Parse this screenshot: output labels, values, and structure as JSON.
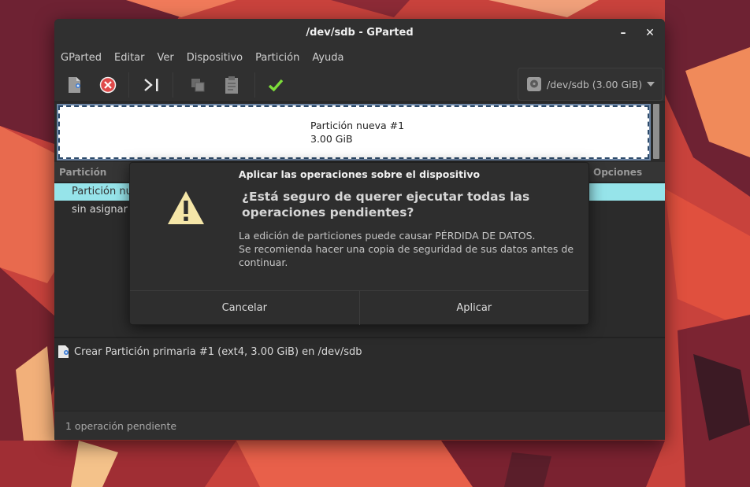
{
  "window": {
    "title": "/dev/sdb - GParted",
    "minimize_glyph": "–",
    "close_glyph": "✕"
  },
  "menubar": [
    "GParted",
    "Editar",
    "Ver",
    "Dispositivo",
    "Partición",
    "Ayuda"
  ],
  "toolbar": {
    "icons": [
      "new-partition-icon",
      "delete-partition-icon",
      "resize-move-icon",
      "copy-icon",
      "paste-icon",
      "apply-checkmark-icon"
    ],
    "device_selector": "/dev/sdb (3.00 GiB)"
  },
  "graphic": {
    "partition_name": "Partición nueva #1",
    "partition_size": "3.00 GiB"
  },
  "partition_list": {
    "col_partition": "Partición",
    "col_options": "Opciones",
    "rows": [
      "Partición nueva #1",
      "sin asignar"
    ]
  },
  "pending": {
    "operation": "Crear Partición primaria #1 (ext4, 3.00 GiB) en /dev/sdb",
    "status": "1 operación pendiente"
  },
  "dialog": {
    "title": "Aplicar las operaciones sobre el dispositivo",
    "question": "¿Está seguro de querer ejecutar todas las operaciones pendientes?",
    "message_line1": "La edición de particiones puede causar PÉRDIDA DE DATOS.",
    "message_line2": "Se recomienda hacer una copia de seguridad de sus datos antes de continuar.",
    "cancel_label": "Cancelar",
    "apply_label": "Aplicar"
  },
  "colors": {
    "selection": "#96e4ea",
    "warning": "#f5e6a8",
    "apply_green": "#7ddd3a"
  }
}
